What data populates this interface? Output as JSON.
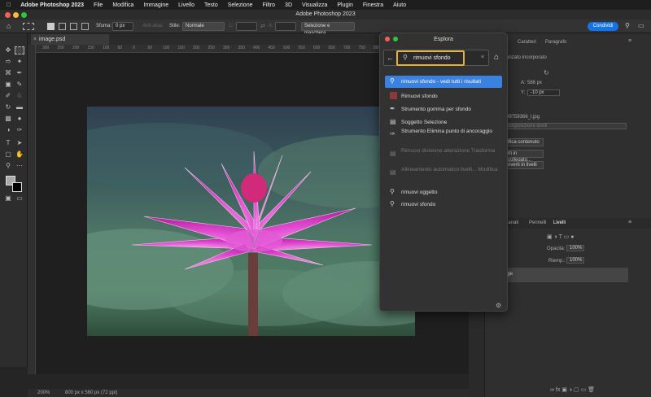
{
  "menubar": {
    "app": "Adobe Photoshop 2023",
    "items": [
      "File",
      "Modifica",
      "Immagine",
      "Livello",
      "Testo",
      "Selezione",
      "Filtro",
      "3D",
      "Visualizza",
      "Plugin",
      "Finestra",
      "Aiuto"
    ]
  },
  "window": {
    "title": "Adobe Photoshop 2023"
  },
  "options_bar": {
    "feather_label": "Sfuma:",
    "feather_value": "0 px",
    "antialias_label": "Anti-alias",
    "style_label": "Stile:",
    "style_value": "Normale",
    "width_label": "L:",
    "height_label": "A:",
    "select_mask_label": "Selezione e maschera...",
    "share_label": "Condividi"
  },
  "document": {
    "tab_label": "image.psd",
    "status_zoom": "200%",
    "status_info": "800 px x 560 px (72 ppi)",
    "ruler_labels": [
      "300",
      "250",
      "200",
      "150",
      "100",
      "50",
      "0",
      "50",
      "100",
      "150",
      "200",
      "250",
      "300",
      "350",
      "400",
      "450",
      "500",
      "550",
      "600",
      "650",
      "700",
      "750",
      "800",
      "850",
      "900",
      "950",
      "1000",
      "1050"
    ]
  },
  "right_panels": {
    "tabs_top": [
      "Proprietà",
      "Caratteri",
      "Paragrafo"
    ],
    "smart_object_label": "anzato incorporato",
    "a_label": "A:",
    "a_value": "586 px",
    "y_label": "Y:",
    "y_value": "-10 px",
    "file_name": "09759366_l.jpg",
    "comp_label": "omposizione livelli",
    "btn_edit": "ifica contenuto",
    "btn_convert_linked": "rti in collegato...",
    "btn_convert_layers": "nverti in livelli",
    "tabs_bottom": [
      "Canali",
      "Pennelli",
      "Livelli"
    ],
    "opacity_label": "Opacità:",
    "opacity_value": "100%",
    "fill_label": "Riemp.:",
    "fill_value": "100%",
    "layer_name": "age"
  },
  "discover": {
    "title": "Esplora",
    "search_value": "rimuovi sfondo",
    "results": [
      {
        "label": "rimuovi sfondo - vedi tutti i risultati",
        "icon": "search-icon",
        "state": "selected"
      },
      {
        "label": "Rimuovi sfondo",
        "icon": "remove-bg-thumb-icon",
        "state": "normal"
      },
      {
        "label": "Strumento gomma per sfondo",
        "icon": "eraser-icon",
        "state": "normal"
      },
      {
        "label": "Soggetto Selezione",
        "icon": "menu-command-icon",
        "state": "normal"
      },
      {
        "label": "Strumento Elimina punto di ancoraggio",
        "icon": "pen-minus-icon",
        "state": "normal"
      },
      {
        "label": "Rimuovi divisione alterazione Trasforma",
        "icon": "menu-command-icon",
        "state": "disabled"
      },
      {
        "label": "Allineamento automatico livelli... Modifica",
        "icon": "menu-command-icon",
        "state": "disabled"
      },
      {
        "label": "rimuovi oggetto",
        "icon": "search-icon",
        "state": "normal"
      },
      {
        "label": "rimuovi sfondo",
        "icon": "search-icon",
        "state": "normal"
      }
    ]
  },
  "colors": {
    "accent": "#3b82e0",
    "highlight": "#e2b23c",
    "share": "#1473e6"
  }
}
